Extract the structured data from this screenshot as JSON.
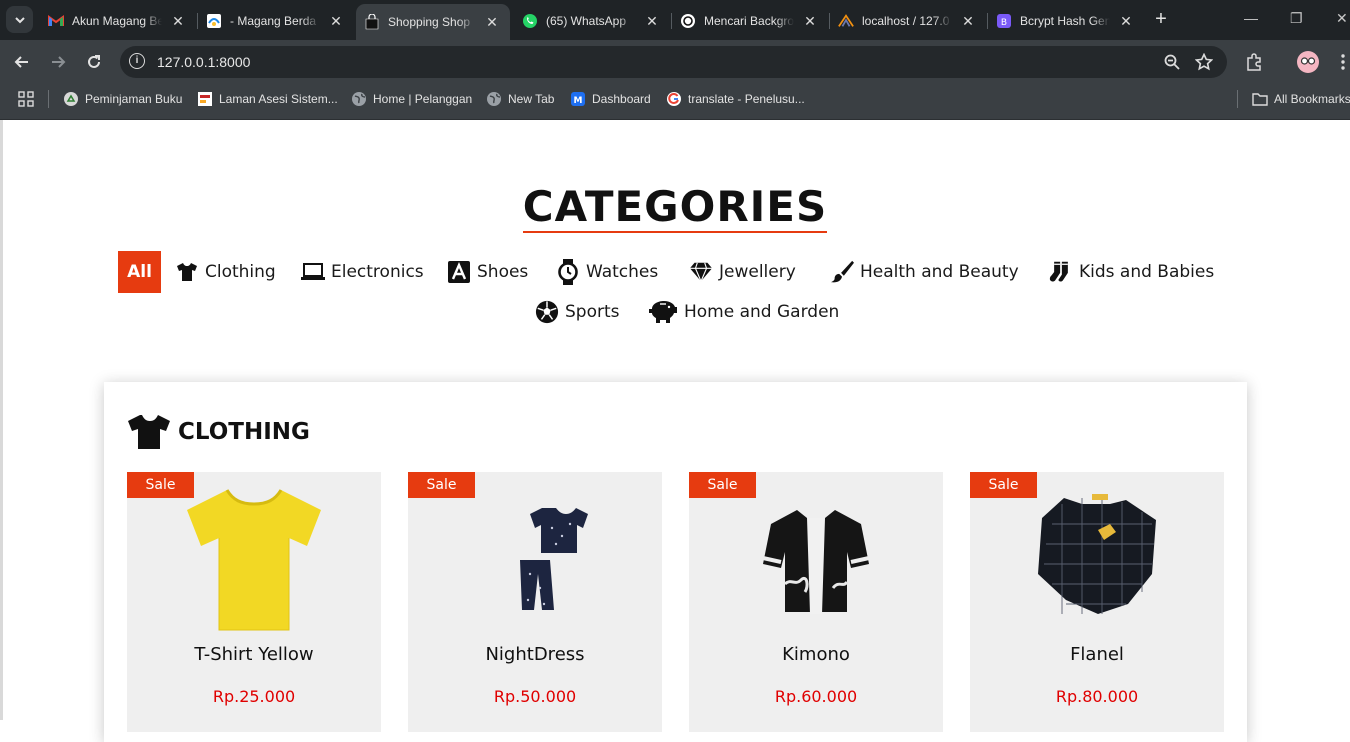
{
  "browser": {
    "tabs": [
      {
        "title": "Akun Magang Be",
        "icon": "gmail-icon"
      },
      {
        "title": "- Magang Berda",
        "icon": "colorful-logo-icon"
      },
      {
        "title": "Shopping Shop",
        "icon": "shopping-bag-icon",
        "active": true
      },
      {
        "title": "(65) WhatsApp",
        "icon": "whatsapp-icon"
      },
      {
        "title": "Mencari Backgro",
        "icon": "openai-icon"
      },
      {
        "title": "localhost / 127.0",
        "icon": "phpmyadmin-icon"
      },
      {
        "title": "Bcrypt Hash Gen",
        "icon": "bcrypt-icon"
      }
    ],
    "url": "127.0.0.1:8000",
    "bookmarks": [
      {
        "label": "Peminjaman Buku",
        "icon": "recycle-icon"
      },
      {
        "label": "Laman Asesi Sistem...",
        "icon": "document-icon"
      },
      {
        "label": "Home | Pelanggan",
        "icon": "globe-icon"
      },
      {
        "label": "New Tab",
        "icon": "globe-icon"
      },
      {
        "label": "Dashboard",
        "icon": "m-logo-icon"
      },
      {
        "label": "translate - Penelusu...",
        "icon": "google-icon"
      }
    ],
    "all_bookmarks": "All Bookmarks"
  },
  "page": {
    "heading": "CATEGORIES",
    "categories": [
      {
        "label": "All",
        "active": true
      },
      {
        "label": "Clothing",
        "icon": "tshirt-icon"
      },
      {
        "label": "Electronics",
        "icon": "laptop-icon"
      },
      {
        "label": "Shoes",
        "icon": "letter-a-icon"
      },
      {
        "label": "Watches",
        "icon": "watch-icon"
      },
      {
        "label": "Jewellery",
        "icon": "diamond-icon"
      },
      {
        "label": "Health and Beauty",
        "icon": "brush-icon"
      },
      {
        "label": "Kids and Babies",
        "icon": "socks-icon"
      },
      {
        "label": "Sports",
        "icon": "soccer-ball-icon"
      },
      {
        "label": "Home and Garden",
        "icon": "piggy-bank-icon"
      }
    ],
    "section": {
      "title": "CLOTHING",
      "products": [
        {
          "badge": "Sale",
          "name": "T-Shirt Yellow",
          "price": "Rp.25.000"
        },
        {
          "badge": "Sale",
          "name": "NightDress",
          "price": "Rp.50.000"
        },
        {
          "badge": "Sale",
          "name": "Kimono",
          "price": "Rp.60.000"
        },
        {
          "badge": "Sale",
          "name": "Flanel",
          "price": "Rp.80.000"
        }
      ]
    }
  },
  "colors": {
    "accent": "#e63b10",
    "price": "#e00000"
  }
}
